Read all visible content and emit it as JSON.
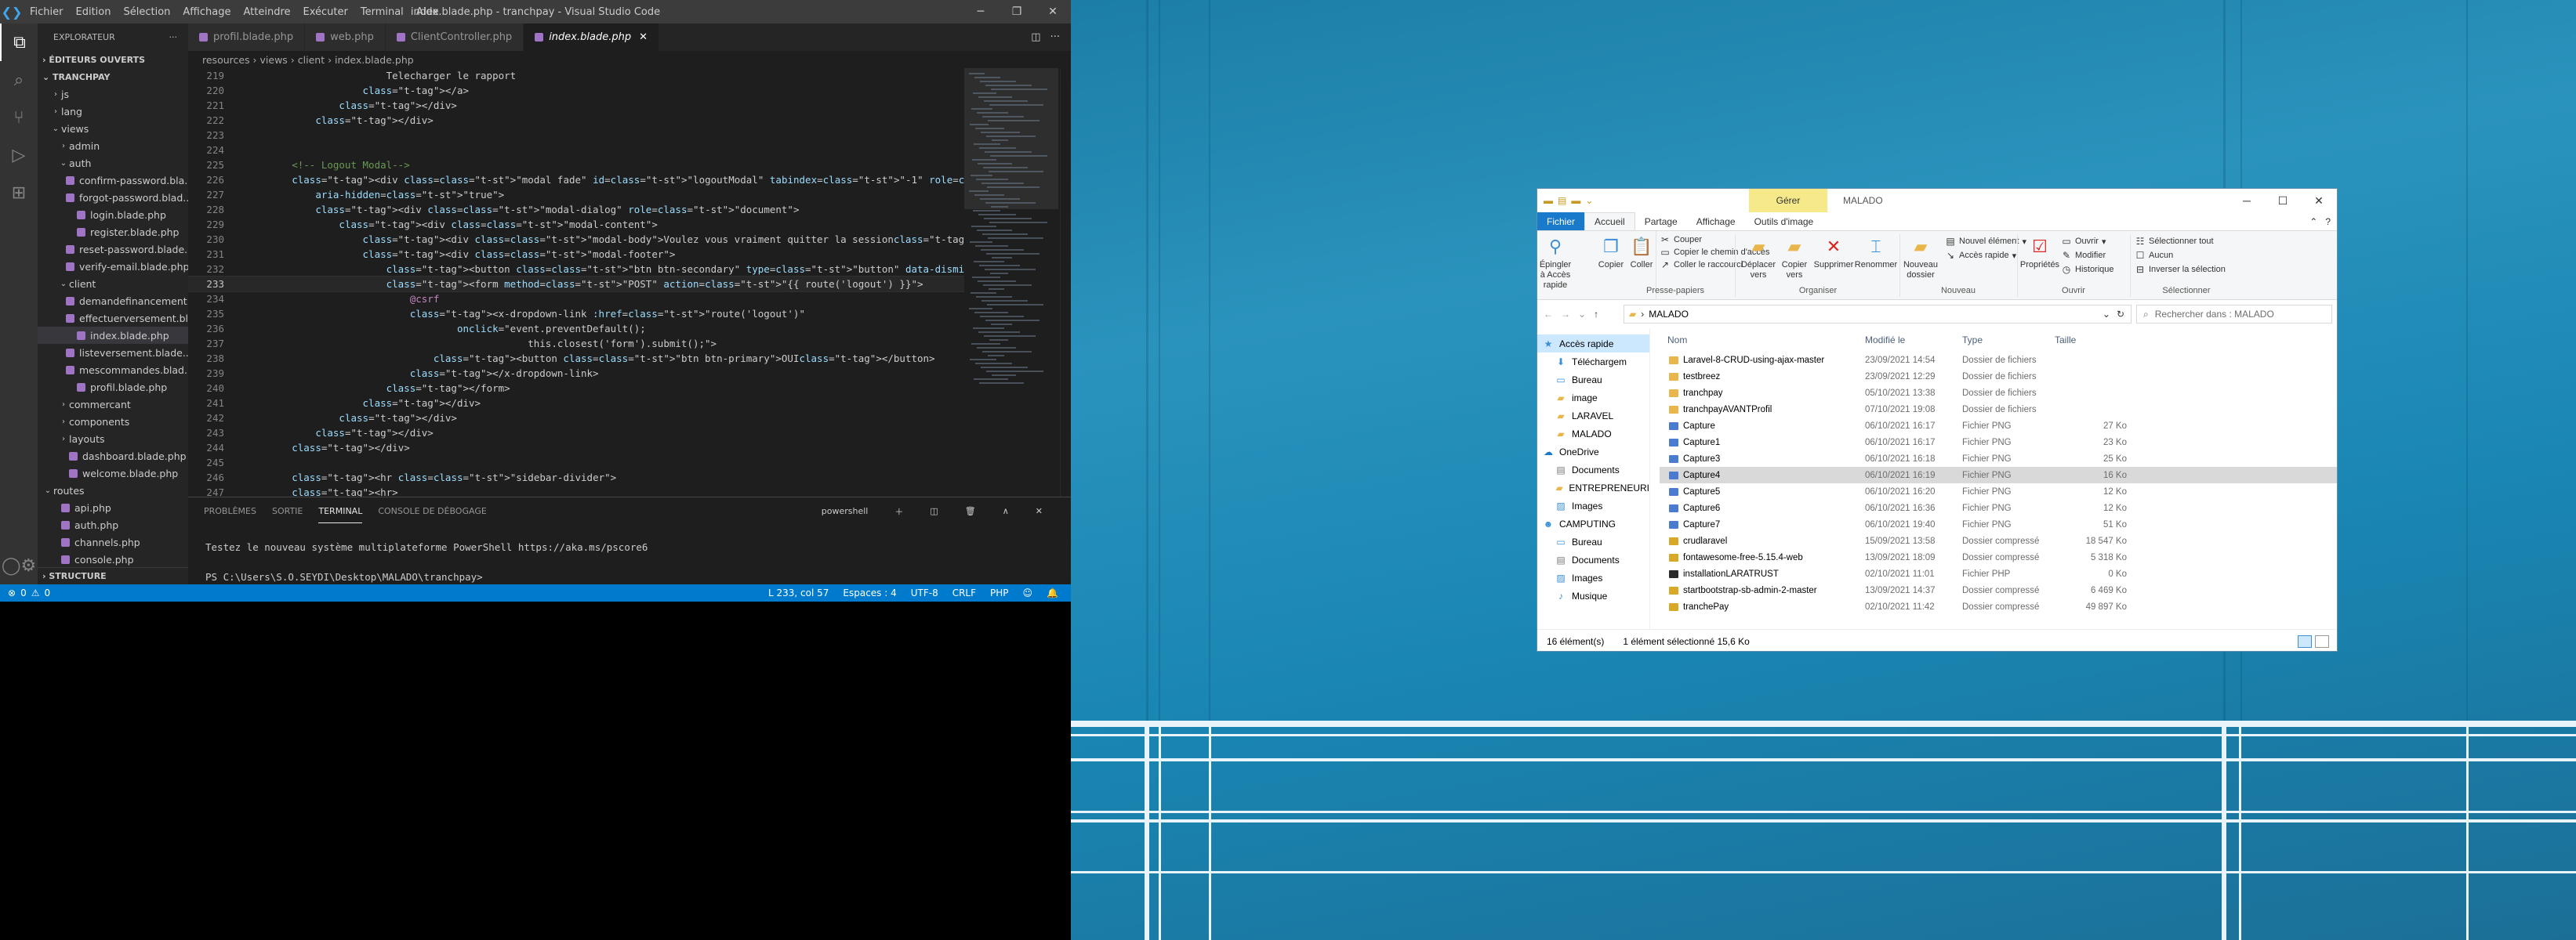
{
  "vscode": {
    "window_title": "index.blade.php - tranchpay - Visual Studio Code",
    "menu": [
      "Fichier",
      "Edition",
      "Sélection",
      "Affichage",
      "Atteindre",
      "Exécuter",
      "Terminal",
      "Aide"
    ],
    "explorer_title": "EXPLORATEUR",
    "open_editors": "ÉDITEURS OUVERTS",
    "project": "TRANCHPAY",
    "tree": [
      {
        "label": "js",
        "depth": 1,
        "kind": "folder",
        "open": false
      },
      {
        "label": "lang",
        "depth": 1,
        "kind": "folder",
        "open": false
      },
      {
        "label": "views",
        "depth": 1,
        "kind": "folder",
        "open": true
      },
      {
        "label": "admin",
        "depth": 2,
        "kind": "folder",
        "open": false
      },
      {
        "label": "auth",
        "depth": 2,
        "kind": "folder",
        "open": true
      },
      {
        "label": "confirm-password.bla...",
        "depth": 3,
        "kind": "file"
      },
      {
        "label": "forgot-password.blad...",
        "depth": 3,
        "kind": "file"
      },
      {
        "label": "login.blade.php",
        "depth": 3,
        "kind": "file"
      },
      {
        "label": "register.blade.php",
        "depth": 3,
        "kind": "file"
      },
      {
        "label": "reset-password.blade....",
        "depth": 3,
        "kind": "file"
      },
      {
        "label": "verify-email.blade.php",
        "depth": 3,
        "kind": "file"
      },
      {
        "label": "client",
        "depth": 2,
        "kind": "folder",
        "open": true
      },
      {
        "label": "demandefinancement...",
        "depth": 3,
        "kind": "file"
      },
      {
        "label": "effectuerversement.bl...",
        "depth": 3,
        "kind": "file"
      },
      {
        "label": "index.blade.php",
        "depth": 3,
        "kind": "file",
        "selected": true
      },
      {
        "label": "listeversement.blade....",
        "depth": 3,
        "kind": "file"
      },
      {
        "label": "mescommandes.blad...",
        "depth": 3,
        "kind": "file"
      },
      {
        "label": "profil.blade.php",
        "depth": 3,
        "kind": "file"
      },
      {
        "label": "commercant",
        "depth": 2,
        "kind": "folder",
        "open": false
      },
      {
        "label": "components",
        "depth": 2,
        "kind": "folder",
        "open": false
      },
      {
        "label": "layouts",
        "depth": 2,
        "kind": "folder",
        "open": false
      },
      {
        "label": "dashboard.blade.php",
        "depth": 2,
        "kind": "file"
      },
      {
        "label": "welcome.blade.php",
        "depth": 2,
        "kind": "file"
      },
      {
        "label": "routes",
        "depth": 0,
        "kind": "folder",
        "open": true
      },
      {
        "label": "api.php",
        "depth": 1,
        "kind": "file"
      },
      {
        "label": "auth.php",
        "depth": 1,
        "kind": "file"
      },
      {
        "label": "channels.php",
        "depth": 1,
        "kind": "file"
      },
      {
        "label": "console.php",
        "depth": 1,
        "kind": "file"
      }
    ],
    "structure": "STRUCTURE",
    "tabs": [
      {
        "label": "profil.blade.php",
        "active": false
      },
      {
        "label": "web.php",
        "active": false
      },
      {
        "label": "ClientController.php",
        "active": false
      },
      {
        "label": "index.blade.php",
        "active": true
      }
    ],
    "breadcrumb": "resources › views › client › index.blade.php",
    "code": [
      {
        "n": "219",
        "t": "                        Telecharger le rapport"
      },
      {
        "n": "220",
        "t": "                    </a>"
      },
      {
        "n": "221",
        "t": "                </div>"
      },
      {
        "n": "222",
        "t": "            </div>"
      },
      {
        "n": "223",
        "t": ""
      },
      {
        "n": "224",
        "t": ""
      },
      {
        "n": "225",
        "t": "        <!-- Logout Modal-->"
      },
      {
        "n": "226",
        "t": "        <div class=\"modal fade\" id=\"logoutModal\" tabindex=\"-1\" role=\"dialog\" aria-labelledby=\"exampleModalLabel\""
      },
      {
        "n": "227",
        "t": "            aria-hidden=\"true\">"
      },
      {
        "n": "228",
        "t": "            <div class=\"modal-dialog\" role=\"document\">"
      },
      {
        "n": "229",
        "t": "                <div class=\"modal-content\">"
      },
      {
        "n": "230",
        "t": "                    <div class=\"modal-body\">Voulez vous vraiment quitter la session</div>"
      },
      {
        "n": "231",
        "t": "                    <div class=\"modal-footer\">"
      },
      {
        "n": "232",
        "t": "                        <button class=\"btn btn-secondary\" type=\"button\" data-dismiss=\"modal\">Annuler</button>"
      },
      {
        "n": "233",
        "t": "                        <form method=\"POST\" action=\"{{ route('logout') }}\">"
      },
      {
        "n": "234",
        "t": "                            @csrf"
      },
      {
        "n": "235",
        "t": "                            <x-dropdown-link :href=\"route('logout')\""
      },
      {
        "n": "236",
        "t": "                                    onclick=\"event.preventDefault();"
      },
      {
        "n": "237",
        "t": "                                                this.closest('form').submit();\">"
      },
      {
        "n": "238",
        "t": "                                <button class=\"btn btn-primary\">OUI</button>"
      },
      {
        "n": "239",
        "t": "                            </x-dropdown-link>"
      },
      {
        "n": "240",
        "t": "                        </form>"
      },
      {
        "n": "241",
        "t": "                    </div>"
      },
      {
        "n": "242",
        "t": "                </div>"
      },
      {
        "n": "243",
        "t": "            </div>"
      },
      {
        "n": "244",
        "t": "        </div>"
      },
      {
        "n": "245",
        "t": ""
      },
      {
        "n": "246",
        "t": "        <hr class=\"sidebar-divider\">"
      },
      {
        "n": "247",
        "t": "        <hr>"
      }
    ],
    "current_line": "233",
    "panel_tabs": [
      "PROBLÈMES",
      "SORTIE",
      "TERMINAL",
      "CONSOLE DE DÉBOGAGE"
    ],
    "panel_active": "TERMINAL",
    "shell": "powershell",
    "terminal": [
      "Testez le nouveau système multiplateforme PowerShell https://aka.ms/pscore6",
      "",
      "PS C:\\Users\\S.O.SEYDI\\Desktop\\MALADO\\tranchpay>"
    ],
    "status": {
      "errors": "0",
      "warnings": "0",
      "position": "L 233, col 57",
      "spaces": "Espaces : 4",
      "encoding": "UTF-8",
      "eol": "CRLF",
      "language": "PHP"
    }
  },
  "explorer": {
    "contextual_tab": "Gérer",
    "title": "MALADO",
    "ribbon_tabs": [
      "Fichier",
      "Accueil",
      "Partage",
      "Affichage",
      "Outils d'image"
    ],
    "ribbon": {
      "pin": "Épingler à Accès rapide",
      "copy": "Copier",
      "paste": "Coller",
      "cut": "Couper",
      "copy_path": "Copier le chemin d'accès",
      "paste_shortcut": "Coller le raccourci",
      "group_clipboard": "Presse-papiers",
      "move_to": "Déplacer vers",
      "copy_to": "Copier vers",
      "delete": "Supprimer",
      "rename": "Renommer",
      "group_organize": "Organiser",
      "new_folder": "Nouveau dossier",
      "new_item": "Nouvel élément",
      "easy_access": "Accès rapide",
      "group_new": "Nouveau",
      "properties": "Propriétés",
      "open": "Ouvrir",
      "edit": "Modifier",
      "history": "Historique",
      "group_open": "Ouvrir",
      "select_all": "Sélectionner tout",
      "select_none": "Aucun",
      "invert": "Inverser la sélection",
      "group_select": "Sélectionner"
    },
    "path": "MALADO",
    "search_placeholder": "Rechercher dans : MALADO",
    "nav": [
      {
        "label": "Accès rapide",
        "icon": "star",
        "selected": true,
        "indent": 0
      },
      {
        "label": "Téléchargem",
        "icon": "download",
        "indent": 1
      },
      {
        "label": "Bureau",
        "icon": "desktop",
        "indent": 1
      },
      {
        "label": "image",
        "icon": "folder",
        "indent": 1
      },
      {
        "label": "LARAVEL",
        "icon": "folder",
        "indent": 1
      },
      {
        "label": "MALADO",
        "icon": "folder",
        "indent": 1
      },
      {
        "label": "OneDrive",
        "icon": "cloud",
        "indent": 0
      },
      {
        "label": "Documents",
        "icon": "docs",
        "indent": 1
      },
      {
        "label": "ENTREPRENEURI",
        "icon": "folder",
        "indent": 1
      },
      {
        "label": "Images",
        "icon": "images",
        "indent": 1
      },
      {
        "label": "CAMPUTING",
        "icon": "user",
        "indent": 0
      },
      {
        "label": "Bureau",
        "icon": "desktop",
        "indent": 1
      },
      {
        "label": "Documents",
        "icon": "docs",
        "indent": 1
      },
      {
        "label": "Images",
        "icon": "images",
        "indent": 1
      },
      {
        "label": "Musique",
        "icon": "music",
        "indent": 1
      }
    ],
    "columns": [
      "Nom",
      "Modifié le",
      "Type",
      "Taille"
    ],
    "files": [
      {
        "name": "Laravel-8-CRUD-using-ajax-master",
        "date": "23/09/2021 14:54",
        "type": "Dossier de fichiers",
        "size": "",
        "kind": "folder"
      },
      {
        "name": "testbreez",
        "date": "23/09/2021 12:29",
        "type": "Dossier de fichiers",
        "size": "",
        "kind": "folder"
      },
      {
        "name": "tranchpay",
        "date": "05/10/2021 13:38",
        "type": "Dossier de fichiers",
        "size": "",
        "kind": "folder"
      },
      {
        "name": "tranchpayAVANTProfil",
        "date": "07/10/2021 19:08",
        "type": "Dossier de fichiers",
        "size": "",
        "kind": "folder"
      },
      {
        "name": "Capture",
        "date": "06/10/2021 16:17",
        "type": "Fichier PNG",
        "size": "27 Ko",
        "kind": "png"
      },
      {
        "name": "Capture1",
        "date": "06/10/2021 16:17",
        "type": "Fichier PNG",
        "size": "23 Ko",
        "kind": "png"
      },
      {
        "name": "Capture3",
        "date": "06/10/2021 16:18",
        "type": "Fichier PNG",
        "size": "25 Ko",
        "kind": "png"
      },
      {
        "name": "Capture4",
        "date": "06/10/2021 16:19",
        "type": "Fichier PNG",
        "size": "16 Ko",
        "kind": "png",
        "selected": true
      },
      {
        "name": "Capture5",
        "date": "06/10/2021 16:20",
        "type": "Fichier PNG",
        "size": "12 Ko",
        "kind": "png"
      },
      {
        "name": "Capture6",
        "date": "06/10/2021 16:36",
        "type": "Fichier PNG",
        "size": "12 Ko",
        "kind": "png"
      },
      {
        "name": "Capture7",
        "date": "06/10/2021 19:40",
        "type": "Fichier PNG",
        "size": "51 Ko",
        "kind": "png"
      },
      {
        "name": "crudlaravel",
        "date": "15/09/2021 13:58",
        "type": "Dossier compressé",
        "size": "18 547 Ko",
        "kind": "zip"
      },
      {
        "name": "fontawesome-free-5.15.4-web",
        "date": "13/09/2021 18:09",
        "type": "Dossier compressé",
        "size": "5 318 Ko",
        "kind": "zip"
      },
      {
        "name": "installationLARATRUST",
        "date": "02/10/2021 11:01",
        "type": "Fichier PHP",
        "size": "0 Ko",
        "kind": "php"
      },
      {
        "name": "startbootstrap-sb-admin-2-master",
        "date": "13/09/2021 14:37",
        "type": "Dossier compressé",
        "size": "6 469 Ko",
        "kind": "zip"
      },
      {
        "name": "tranchePay",
        "date": "02/10/2021 11:42",
        "type": "Dossier compressé",
        "size": "49 897 Ko",
        "kind": "zip"
      }
    ],
    "status_count": "16 élément(s)",
    "status_selected": "1 élément sélectionné  15,6 Ko"
  }
}
